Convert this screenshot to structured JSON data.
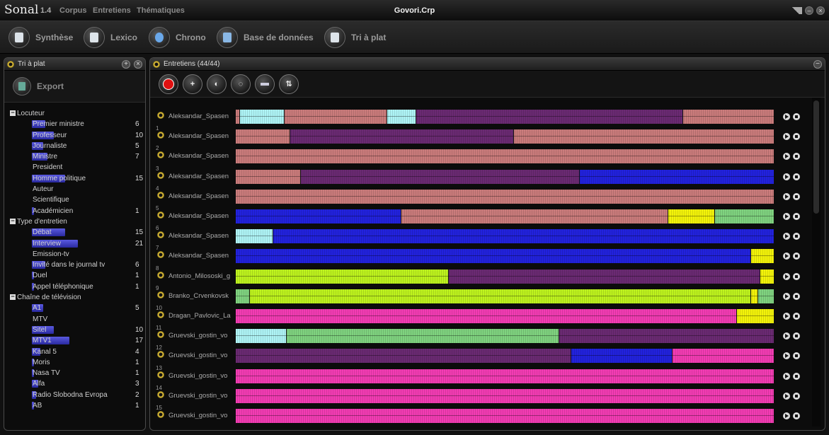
{
  "app": {
    "logo": "Sonal",
    "version": "1.4",
    "menu": [
      "Corpus",
      "Entretiens",
      "Thématiques"
    ],
    "document_title": "Govori.Crp"
  },
  "toolbar": {
    "items": [
      {
        "label": "Synthèse",
        "icon": "synthesis-icon"
      },
      {
        "label": "Lexico",
        "icon": "lexico-icon"
      },
      {
        "label": "Chrono",
        "icon": "chrono-icon"
      },
      {
        "label": "Base de données",
        "icon": "database-icon"
      },
      {
        "label": "Tri à plat",
        "icon": "flat-sort-icon"
      }
    ]
  },
  "left_panel": {
    "title": "Tri à plat",
    "export_label": "Export",
    "categories": [
      {
        "label": "Locuteur",
        "items": [
          {
            "label": "Premier ministre",
            "count": "6",
            "bar": 6
          },
          {
            "label": "Professeur",
            "count": "10",
            "bar": 10
          },
          {
            "label": "Journaliste",
            "count": "5",
            "bar": 5
          },
          {
            "label": "Ministre",
            "count": "7",
            "bar": 7
          },
          {
            "label": "President",
            "count": "",
            "bar": 0
          },
          {
            "label": "Homme politique",
            "count": "15",
            "bar": 15
          },
          {
            "label": "Auteur",
            "count": "",
            "bar": 0
          },
          {
            "label": "Scientifique",
            "count": "",
            "bar": 0
          },
          {
            "label": "Académicien",
            "count": "1",
            "bar": 1
          }
        ]
      },
      {
        "label": "Type d'entretien",
        "items": [
          {
            "label": "Débat",
            "count": "15",
            "bar": 15
          },
          {
            "label": "Interview",
            "count": "21",
            "bar": 21
          },
          {
            "label": "Emission-tv",
            "count": "",
            "bar": 0
          },
          {
            "label": "Invité dans le journal tv",
            "count": "6",
            "bar": 6
          },
          {
            "label": "Duel",
            "count": "1",
            "bar": 1
          },
          {
            "label": "Appel téléphonique",
            "count": "1",
            "bar": 1
          }
        ]
      },
      {
        "label": "Chaîne de télévision",
        "items": [
          {
            "label": "A1",
            "count": "5",
            "bar": 5
          },
          {
            "label": "MTV",
            "count": "",
            "bar": 0
          },
          {
            "label": "Sitel",
            "count": "10",
            "bar": 10
          },
          {
            "label": "MTV1",
            "count": "17",
            "bar": 17
          },
          {
            "label": "Kanal 5",
            "count": "4",
            "bar": 4
          },
          {
            "label": "Moris",
            "count": "1",
            "bar": 1
          },
          {
            "label": "Nasa TV",
            "count": "1",
            "bar": 1
          },
          {
            "label": "Alfa",
            "count": "3",
            "bar": 3
          },
          {
            "label": "Radio Slobodna Evropa",
            "count": "2",
            "bar": 2
          },
          {
            "label": "AB",
            "count": "1",
            "bar": 1
          }
        ]
      }
    ]
  },
  "right_panel": {
    "title": "Entretiens (44/44)",
    "tools": [
      "record-icon",
      "add-segment-icon",
      "zoom-in-icon",
      "zoom-out-icon",
      "split-view-icon",
      "sort-icon"
    ],
    "colors": {
      "pink": "#c97b7b",
      "purple": "#6a2a72",
      "cyan": "#aef3f5",
      "blue": "#2222dd",
      "yellow": "#f2f20a",
      "lime": "#bdf21e",
      "green": "#7fd27f",
      "magenta": "#f23cb3"
    },
    "tracks": [
      {
        "num": "",
        "name": "Aleksandar_Spasen",
        "segs": [
          [
            "pink",
            0,
            0.007
          ],
          [
            "cyan",
            0.007,
            0.09
          ],
          [
            "pink",
            0.09,
            0.28
          ],
          [
            "cyan",
            0.28,
            0.334
          ],
          [
            "purple",
            0.334,
            0.83
          ],
          [
            "pink",
            0.83,
            1
          ]
        ]
      },
      {
        "num": "1",
        "name": "Aleksandar_Spasen",
        "segs": [
          [
            "pink",
            0,
            0.1
          ],
          [
            "purple",
            0.1,
            0.516
          ],
          [
            "pink",
            0.516,
            1
          ]
        ]
      },
      {
        "num": "2",
        "name": "Aleksandar_Spasen",
        "segs": [
          [
            "pink",
            0,
            1
          ]
        ]
      },
      {
        "num": "3",
        "name": "Aleksandar_Spasen",
        "segs": [
          [
            "pink",
            0,
            0.12
          ],
          [
            "purple",
            0.12,
            0.638
          ],
          [
            "blue",
            0.638,
            1
          ]
        ]
      },
      {
        "num": "4",
        "name": "Aleksandar_Spasen",
        "segs": [
          [
            "pink",
            0,
            1
          ]
        ]
      },
      {
        "num": "5",
        "name": "Aleksandar_Spasen",
        "segs": [
          [
            "blue",
            0,
            0.306
          ],
          [
            "pink",
            0.306,
            0.803
          ],
          [
            "yellow",
            0.803,
            0.89
          ],
          [
            "green",
            0.89,
            1
          ]
        ]
      },
      {
        "num": "6",
        "name": "Aleksandar_Spasen",
        "segs": [
          [
            "cyan",
            0,
            0.068
          ],
          [
            "blue",
            0.068,
            1
          ]
        ]
      },
      {
        "num": "7",
        "name": "Aleksandar_Spasen",
        "segs": [
          [
            "blue",
            0,
            0.956
          ],
          [
            "yellow",
            0.956,
            1
          ]
        ]
      },
      {
        "num": "8",
        "name": "Antonio_Milososki_g",
        "segs": [
          [
            "lime",
            0,
            0.395
          ],
          [
            "purple",
            0.395,
            0.974
          ],
          [
            "yellow",
            0.974,
            1
          ]
        ]
      },
      {
        "num": "9",
        "name": "Branko_Crvenkovsk",
        "segs": [
          [
            "green",
            0,
            0.025
          ],
          [
            "lime",
            0.025,
            0.957
          ],
          [
            "yellow",
            0.957,
            0.97
          ],
          [
            "green",
            0.97,
            1
          ]
        ]
      },
      {
        "num": "10",
        "name": "Dragan_Pavlovic_La",
        "segs": [
          [
            "magenta",
            0,
            0.93
          ],
          [
            "yellow",
            0.93,
            1
          ]
        ]
      },
      {
        "num": "11",
        "name": "Gruevski_gostin_vo",
        "segs": [
          [
            "cyan",
            0,
            0.093
          ],
          [
            "green",
            0.093,
            0.6
          ],
          [
            "purple",
            0.6,
            1
          ]
        ]
      },
      {
        "num": "12",
        "name": "Gruevski_gostin_vo",
        "segs": [
          [
            "purple",
            0,
            0.623
          ],
          [
            "blue",
            0.623,
            0.81
          ],
          [
            "magenta",
            0.81,
            1
          ]
        ]
      },
      {
        "num": "13",
        "name": "Gruevski_gostin_vo",
        "segs": [
          [
            "magenta",
            0,
            1
          ]
        ]
      },
      {
        "num": "14",
        "name": "Gruevski_gostin_vo",
        "segs": [
          [
            "magenta",
            0,
            1
          ]
        ]
      },
      {
        "num": "15",
        "name": "Gruevski_gostin_vo",
        "segs": [
          [
            "magenta",
            0,
            1
          ]
        ]
      }
    ]
  }
}
